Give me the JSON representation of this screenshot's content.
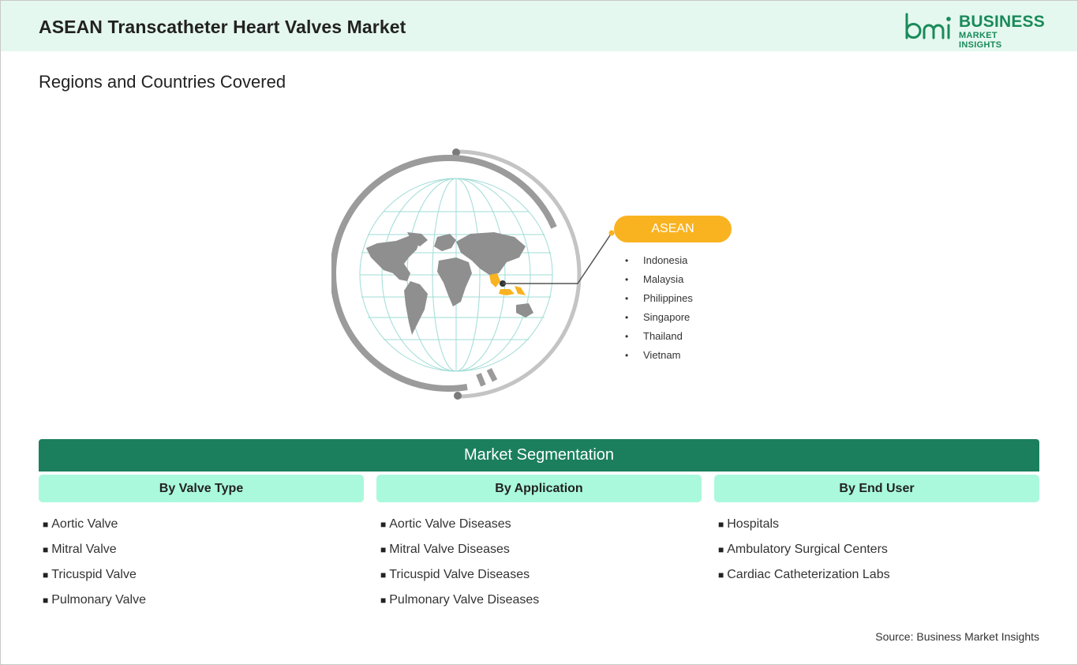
{
  "header": {
    "title": "ASEAN Transcatheter Heart Valves Market",
    "logo": {
      "mark_text": "bmi",
      "line1": "BUSINESS",
      "line2": "MARKET INSIGHTS",
      "color": "#1a8a5a"
    }
  },
  "section_title": "Regions and Countries Covered",
  "region": {
    "name": "ASEAN",
    "color": "#f9b320",
    "countries": [
      "Indonesia",
      "Malaysia",
      "Philippines",
      "Singapore",
      "Thailand",
      "Vietnam"
    ]
  },
  "segmentation": {
    "title": "Market Segmentation",
    "bar_color": "#1b7f5e",
    "header_color": "#aaf9dd",
    "columns": [
      {
        "heading": "By Valve Type",
        "items": [
          "Aortic Valve",
          "Mitral Valve",
          "Tricuspid Valve",
          "Pulmonary Valve"
        ]
      },
      {
        "heading": "By Application",
        "items": [
          "Aortic Valve Diseases",
          "Mitral Valve Diseases",
          "Tricuspid Valve Diseases",
          "Pulmonary Valve Diseases"
        ]
      },
      {
        "heading": "By End User",
        "items": [
          "Hospitals",
          "Ambulatory Surgical Centers",
          "Cardiac Catheterization Labs"
        ]
      }
    ]
  },
  "source": "Source: Business Market Insights"
}
